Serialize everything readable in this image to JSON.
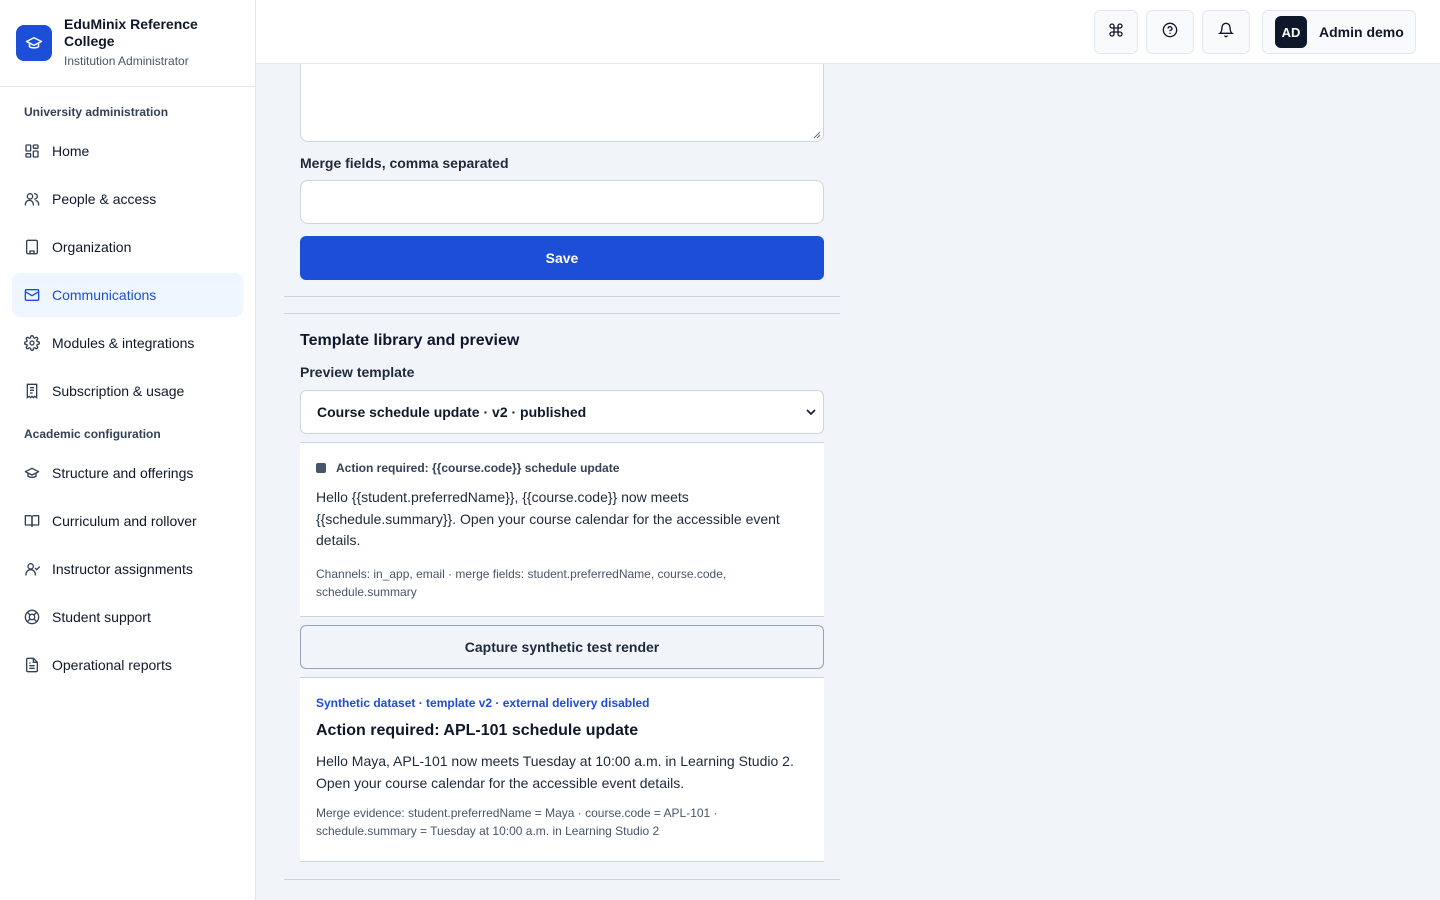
{
  "brand": {
    "name": "EduMinix Reference College",
    "role": "Institution Administrator"
  },
  "nav": {
    "section1": "University administration",
    "section2": "Academic configuration",
    "items1": [
      {
        "label": "Home",
        "icon": "dashboard-icon"
      },
      {
        "label": "People & access",
        "icon": "users-icon"
      },
      {
        "label": "Organization",
        "icon": "building-icon"
      },
      {
        "label": "Communications",
        "icon": "mail-icon",
        "active": true
      },
      {
        "label": "Modules & integrations",
        "icon": "gear-icon"
      },
      {
        "label": "Subscription & usage",
        "icon": "receipt-icon"
      }
    ],
    "items2": [
      {
        "label": "Structure and offerings",
        "icon": "graduation-cap-icon"
      },
      {
        "label": "Curriculum and rollover",
        "icon": "book-open-icon"
      },
      {
        "label": "Instructor assignments",
        "icon": "user-icon"
      },
      {
        "label": "Student support",
        "icon": "lifebuoy-icon"
      },
      {
        "label": "Operational reports",
        "icon": "file-text-icon"
      }
    ]
  },
  "topbar": {
    "avatar_initials": "AD",
    "user_name": "Admin demo"
  },
  "form": {
    "merge_label": "Merge fields, comma separated",
    "merge_value": "",
    "save_label": "Save"
  },
  "library": {
    "title": "Template library and preview",
    "preview_label": "Preview template",
    "selected_template": "Course schedule update · v2 · published",
    "subject": "Action required: {{course.code}} schedule update",
    "body": "Hello {{student.preferredName}}, {{course.code}} now meets {{schedule.summary}}. Open your course calendar for the accessible event details.",
    "meta": "Channels: in_app, email · merge fields: student.preferredName, course.code, schedule.summary",
    "capture_label": "Capture synthetic test render"
  },
  "render": {
    "badge": "Synthetic dataset · template v2 · external delivery disabled",
    "subject": "Action required: APL-101 schedule update",
    "body": "Hello Maya, APL-101 now meets Tuesday at 10:00 a.m. in Learning Studio 2. Open your course calendar for the accessible event details.",
    "evidence": "Merge evidence: student.preferredName = Maya · course.code = APL-101 · schedule.summary = Tuesday at 10:00 a.m. in Learning Studio 2"
  },
  "colors": {
    "accent": "#1d4ed8",
    "active_bg": "#eff6ff",
    "background": "#f1f5f9"
  }
}
